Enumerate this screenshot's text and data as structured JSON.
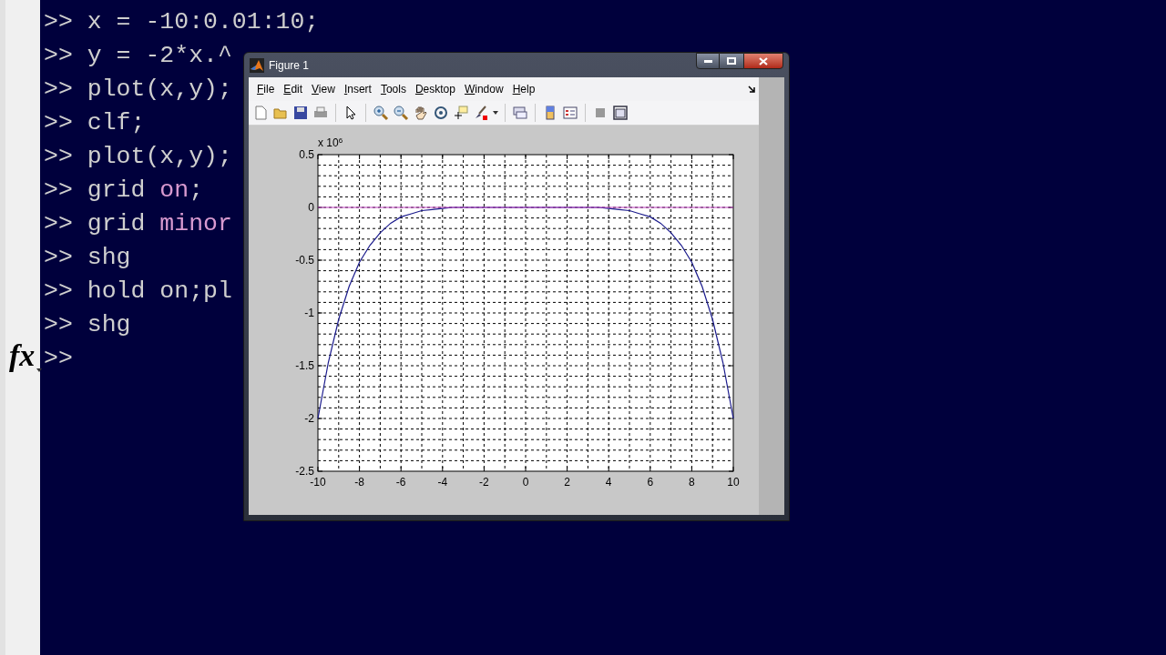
{
  "command_window": {
    "lines": [
      {
        "prompt": ">>",
        "parts": [
          {
            "kind": "code",
            "text": "x = -10:0.01:10;"
          }
        ]
      },
      {
        "prompt": ">>",
        "parts": [
          {
            "kind": "code",
            "text": "y = -2*x.^"
          }
        ]
      },
      {
        "prompt": ">>",
        "parts": [
          {
            "kind": "code",
            "text": "plot(x,y);"
          }
        ]
      },
      {
        "prompt": ">>",
        "parts": [
          {
            "kind": "code",
            "text": "clf;"
          }
        ]
      },
      {
        "prompt": ">>",
        "parts": [
          {
            "kind": "code",
            "text": "plot(x,y);"
          }
        ]
      },
      {
        "prompt": ">>",
        "parts": [
          {
            "kind": "code",
            "text": "grid "
          },
          {
            "kind": "string",
            "text": "on"
          },
          {
            "kind": "code",
            "text": ";"
          }
        ]
      },
      {
        "prompt": ">>",
        "parts": [
          {
            "kind": "code",
            "text": "grid "
          },
          {
            "kind": "string",
            "text": "minor"
          }
        ]
      },
      {
        "prompt": ">>",
        "parts": [
          {
            "kind": "code",
            "text": "shg"
          }
        ]
      },
      {
        "prompt": ">>",
        "parts": [
          {
            "kind": "code",
            "text": "hold on;pl"
          }
        ]
      },
      {
        "prompt": ">>",
        "parts": [
          {
            "kind": "code",
            "text": "shg"
          }
        ]
      },
      {
        "prompt": ">>"
      }
    ],
    "function_button": "fx"
  },
  "figure_window": {
    "title": "Figure 1",
    "menu": [
      "File",
      "Edit",
      "View",
      "Insert",
      "Tools",
      "Desktop",
      "Window",
      "Help"
    ],
    "exponent_label": "x 10$^{6}$",
    "chart_data": {
      "type": "line",
      "x": [
        -10,
        -9.5,
        -9,
        -8.5,
        -8,
        -7.5,
        -7,
        -6.5,
        -6,
        -5.5,
        -5,
        -4.5,
        -4,
        -3.5,
        -3,
        -2.5,
        -2,
        -1.5,
        -1,
        -0.5,
        0,
        0.5,
        1,
        1.5,
        2,
        2.5,
        3,
        3.5,
        4,
        4.5,
        5,
        5.5,
        6,
        6.5,
        7,
        7.5,
        8,
        8.5,
        9,
        9.5,
        10
      ],
      "series": [
        {
          "color": "#1a1a8c",
          "values": [
            -2.0,
            -1.47,
            -1.06,
            -0.75,
            -0.52,
            -0.36,
            -0.24,
            -0.15,
            -0.09,
            -0.06,
            -0.03,
            -0.02,
            -0.01,
            0,
            0,
            0,
            0,
            0,
            0,
            0,
            0,
            0,
            0,
            0,
            0,
            0,
            0,
            0,
            -0.01,
            -0.02,
            -0.03,
            -0.06,
            -0.09,
            -0.15,
            -0.24,
            -0.36,
            -0.52,
            -0.75,
            -1.06,
            -1.47,
            -2.0
          ]
        },
        {
          "color": "#c040c0",
          "values": [
            0,
            0,
            0,
            0,
            0,
            0,
            0,
            0,
            0,
            0,
            0,
            0,
            0,
            0,
            0,
            0,
            0,
            0,
            0,
            0,
            0,
            0,
            0,
            0,
            0,
            0,
            0,
            0,
            0,
            0,
            0,
            0,
            0,
            0,
            0,
            0,
            0,
            0,
            0,
            0,
            0
          ]
        }
      ],
      "grid": true,
      "xlim": [
        -10,
        10
      ],
      "ylim": [
        -2.5,
        0.5
      ],
      "xticks": [
        -10,
        -8,
        -6,
        -4,
        -2,
        0,
        2,
        4,
        6,
        8,
        10
      ],
      "yticks": [
        {
          "value": -2.5,
          "label": "-2.5"
        },
        {
          "value": -2,
          "label": "-2"
        },
        {
          "value": -1.5,
          "label": "-1.5"
        },
        {
          "value": -1,
          "label": "-1"
        },
        {
          "value": -0.5,
          "label": "-0.5"
        },
        {
          "value": 0,
          "label": "0"
        },
        {
          "value": 0.5,
          "label": "0.5"
        }
      ]
    }
  }
}
